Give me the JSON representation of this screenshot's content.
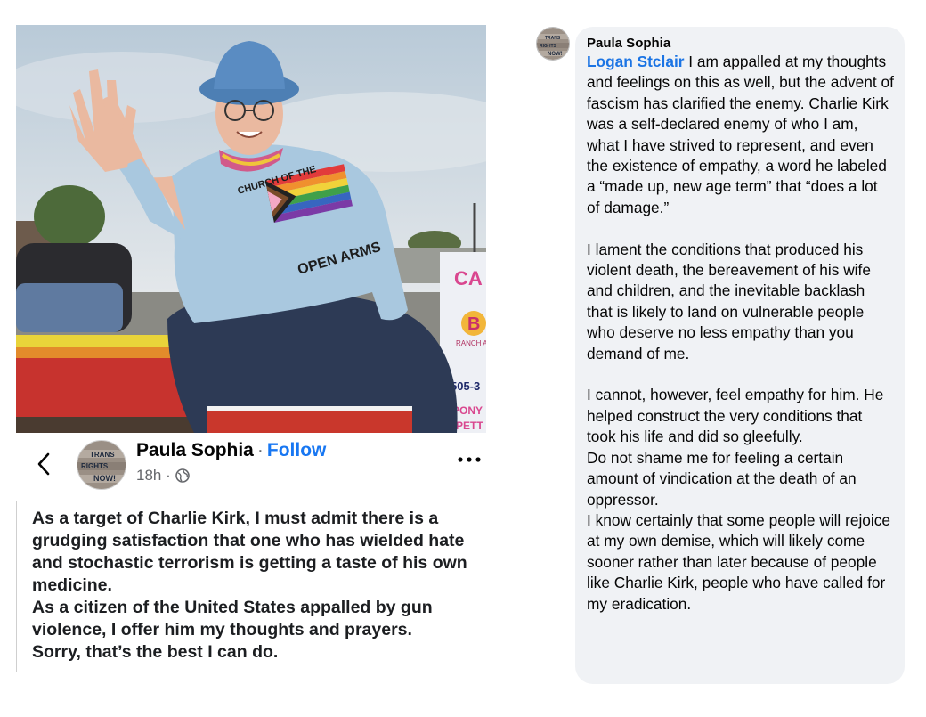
{
  "post": {
    "author": "Paula Sophia",
    "separator": "·",
    "follow": "Follow",
    "time": "18h ·",
    "text": "As a target of Charlie Kirk, I must admit there is a grudging satisfaction that one who has wielded hate and stochastic terrorism is getting a taste of his own medicine.\nAs a citizen of the United States appalled by gun violence, I offer him my thoughts and prayers.\nSorry, that’s the best I can do.",
    "icons": [
      "back-arrow-icon",
      "globe-icon",
      "more-icon"
    ],
    "photo": {
      "shirt_text_top": "CHURCH OF THE",
      "shirt_text_bottom": "OPEN ARMS",
      "sign_text": "CA",
      "sign_brand": "B",
      "sign_subtext": "RANCH ART",
      "sign_phone": "505-3",
      "sign_pony": "PONY",
      "sign_pet": "PETT"
    },
    "avatar_text": [
      "TRANS",
      "RIGHTS",
      "NOW!"
    ]
  },
  "comment": {
    "author": "Paula Sophia",
    "mention": "Logan Stclair",
    "paragraphs": [
      " I am appalled at my thoughts and feelings on this as well, but the advent of fascism has clarified the enemy. Charlie Kirk was a self-declared enemy of who I am, what I have strived to represent, and even the existence of empathy, a word he labeled a “made up, new age term” that “does a lot of damage.”",
      "I lament the conditions that produced his violent death, the bereavement of his wife and children, and the inevitable backlash that is likely to land on vulnerable people who deserve no less empathy than you demand of me.",
      "I cannot, however, feel empathy for him. He helped construct the very conditions that took his life and did so gleefully.",
      "Do not shame me for feeling a certain amount of vindication at the death of an oppressor.",
      "I know certainly that some people will rejoice at my own demise, which will likely come sooner rather than later because of people like Charlie Kirk, people who have called for my eradication."
    ]
  }
}
